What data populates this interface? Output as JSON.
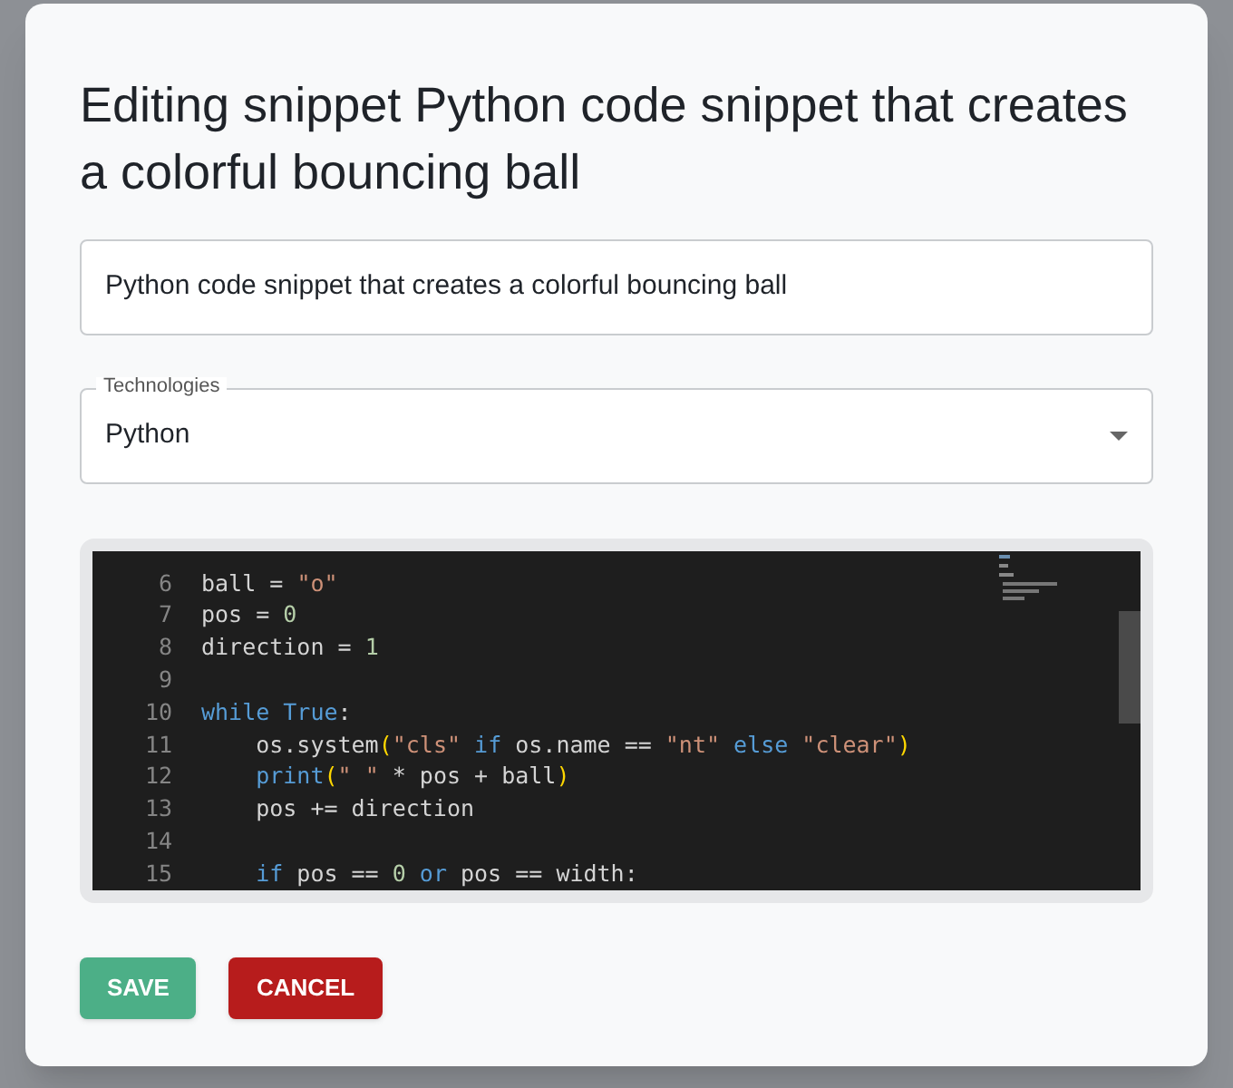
{
  "dialog": {
    "title": "Editing snippet Python code snippet that creates a colorful bouncing ball",
    "name_field": {
      "value": "Python code snippet that creates a colorful bouncing ball"
    },
    "technologies": {
      "label": "Technologies",
      "value": "Python"
    },
    "editor": {
      "lines": [
        {
          "number": "6",
          "tokens": [
            {
              "kind": "plain",
              "text": "ball = "
            },
            {
              "kind": "string",
              "text": "\"o\""
            }
          ]
        },
        {
          "number": "7",
          "tokens": [
            {
              "kind": "plain",
              "text": "pos = "
            },
            {
              "kind": "number",
              "text": "0"
            }
          ]
        },
        {
          "number": "8",
          "tokens": [
            {
              "kind": "plain",
              "text": "direction = "
            },
            {
              "kind": "number",
              "text": "1"
            }
          ]
        },
        {
          "number": "9"
        },
        {
          "number": "10",
          "tokens": [
            {
              "kind": "keyword",
              "text": "while True"
            },
            {
              "kind": "plain",
              "text": ":"
            }
          ]
        },
        {
          "number": "11",
          "tokens": [
            {
              "kind": "plain",
              "text": "    os.system"
            },
            {
              "kind": "paren",
              "text": "("
            },
            {
              "kind": "string",
              "text": "\"cls\""
            },
            {
              "kind": "keyword",
              "text": " if"
            },
            {
              "kind": "plain",
              "text": " os.name == "
            },
            {
              "kind": "string",
              "text": "\"nt\""
            },
            {
              "kind": "keyword",
              "text": " else"
            },
            {
              "kind": "string",
              "text": " \"clear\""
            },
            {
              "kind": "paren",
              "text": ")"
            }
          ]
        },
        {
          "number": "12",
          "tokens": [
            {
              "kind": "keyword",
              "text": "    print"
            },
            {
              "kind": "paren",
              "text": "("
            },
            {
              "kind": "string",
              "text": "\" \""
            },
            {
              "kind": "plain",
              "text": " * pos + ball"
            },
            {
              "kind": "paren",
              "text": ")"
            }
          ]
        },
        {
          "number": "13",
          "tokens": [
            {
              "kind": "plain",
              "text": "    pos += direction"
            }
          ]
        },
        {
          "number": "14"
        },
        {
          "number": "15",
          "tokens": [
            {
              "kind": "keyword",
              "text": "    if"
            },
            {
              "kind": "plain",
              "text": " pos == "
            },
            {
              "kind": "number",
              "text": "0"
            },
            {
              "kind": "keyword",
              "text": " or"
            },
            {
              "kind": "plain",
              "text": " pos == width:"
            }
          ]
        }
      ]
    },
    "buttons": [
      {
        "kind": "save",
        "label": "SAVE"
      },
      {
        "kind": "cancel",
        "label": "CANCEL"
      }
    ]
  }
}
